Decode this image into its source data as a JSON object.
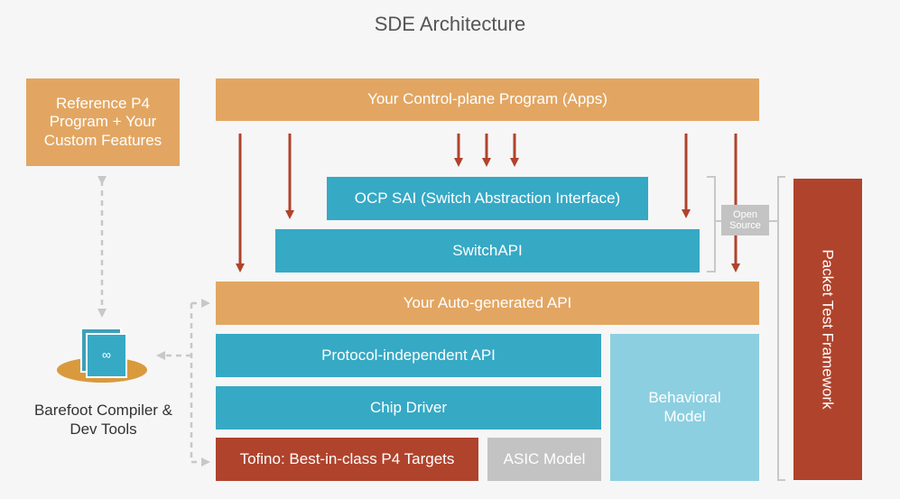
{
  "diagram": {
    "title": "SDE Architecture",
    "boxes": {
      "reference_p4": "Reference P4 Program + Your Custom Features",
      "control_plane": "Your Control-plane Program (Apps)",
      "ocp_sai": "OCP SAI (Switch Abstraction Interface)",
      "switch_api": "SwitchAPI",
      "auto_api": "Your Auto-generated API",
      "protocol_api": "Protocol-independent API",
      "chip_driver": "Chip Driver",
      "tofino": "Tofino: Best-in-class P4 Targets",
      "asic_model": "ASIC Model",
      "behavioral_model": "Behavioral Model",
      "packet_test_framework": "Packet Test Framework",
      "open_source": "Open Source"
    },
    "compiler_label": "Barefoot Compiler & Dev Tools",
    "colors": {
      "orange": "#e2a662",
      "blue": "#36a9c5",
      "light_blue": "#8ccfe0",
      "red": "#b0432c",
      "gray": "#c3c3c3",
      "arrow": "#b0432c",
      "dashed": "#c8c8c8"
    }
  }
}
